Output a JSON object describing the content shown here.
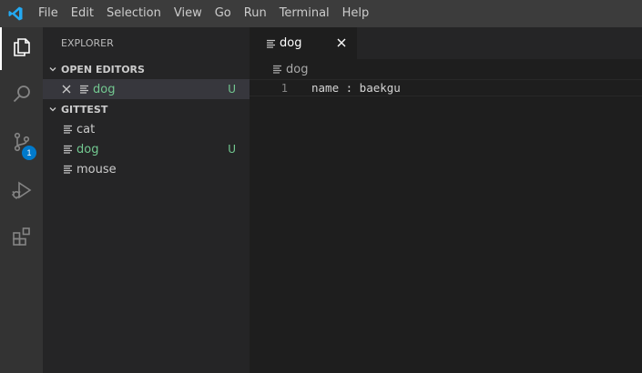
{
  "menu": [
    "File",
    "Edit",
    "Selection",
    "View",
    "Go",
    "Run",
    "Terminal",
    "Help"
  ],
  "activity": {
    "scm_badge": "1"
  },
  "sidebar": {
    "title": "EXPLORER",
    "open_editors": {
      "header": "OPEN EDITORS",
      "items": [
        {
          "name": "dog",
          "status": "U"
        }
      ]
    },
    "project": {
      "header": "GITTEST",
      "files": [
        {
          "name": "cat",
          "status": ""
        },
        {
          "name": "dog",
          "status": "U"
        },
        {
          "name": "mouse",
          "status": ""
        }
      ]
    }
  },
  "editor": {
    "tab_label": "dog",
    "breadcrumb": "dog",
    "lines": [
      {
        "number": "1",
        "text": "name : baekgu"
      }
    ]
  },
  "colors": {
    "accent": "#007acc",
    "modified": "#73c991",
    "logo": "#23a9f2"
  }
}
